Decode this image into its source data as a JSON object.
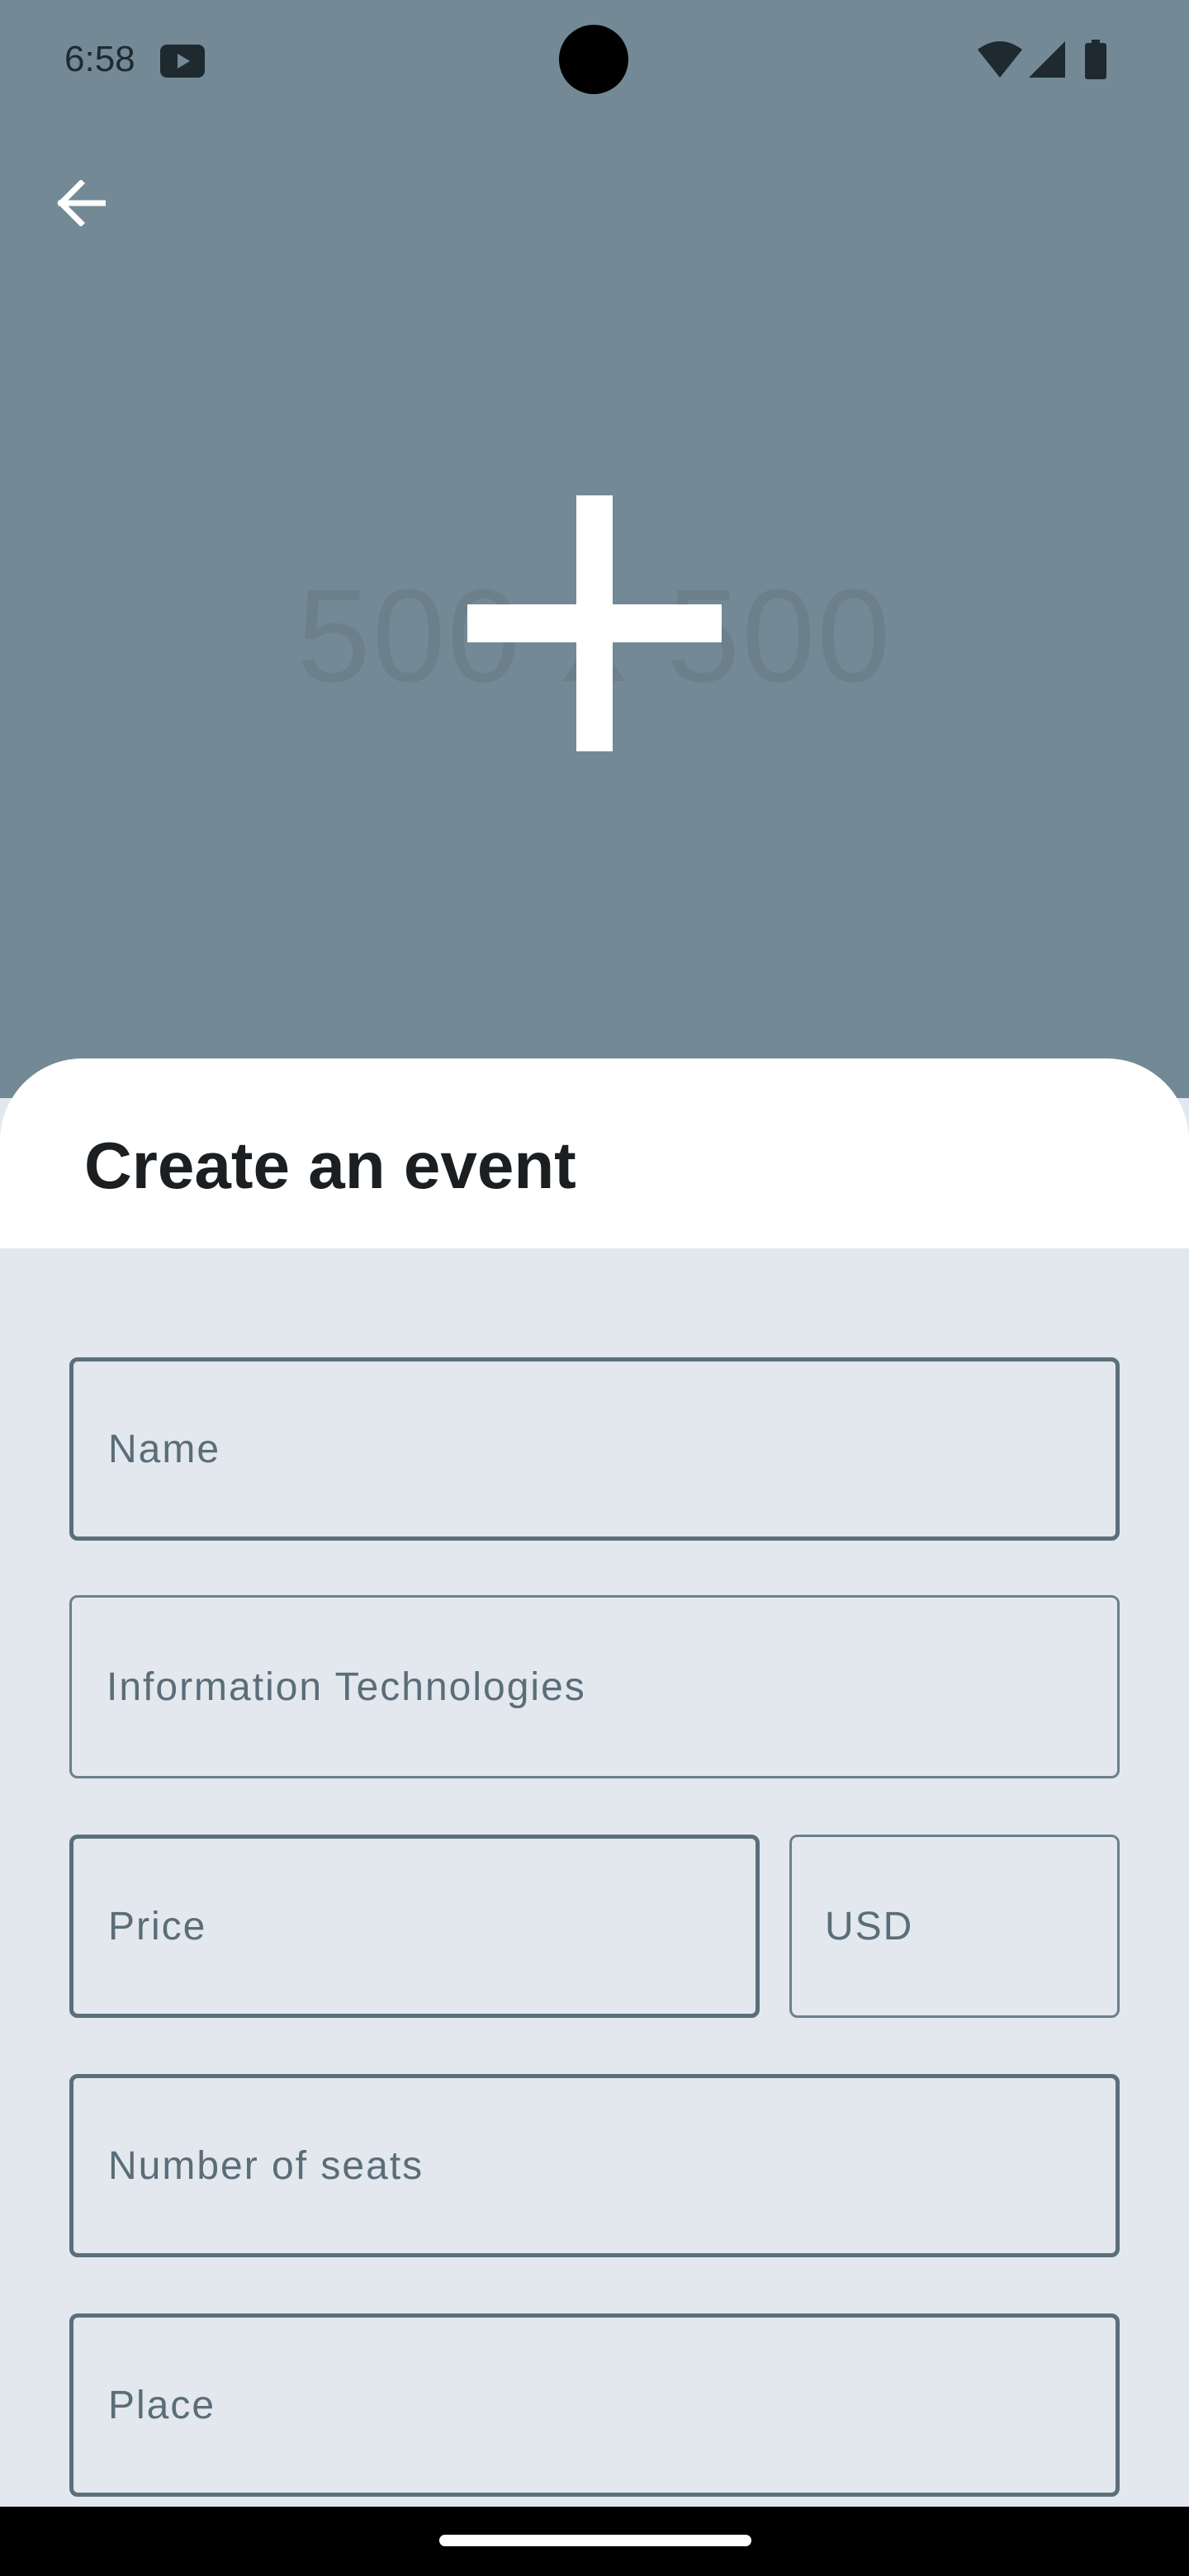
{
  "status_bar": {
    "time": "6:58"
  },
  "header": {
    "back_icon": "arrow-left-icon",
    "image_placeholder_text": "500 x 500",
    "add_image_icon": "plus-icon",
    "background_color": "#738a96"
  },
  "sheet": {
    "title": "Create an event"
  },
  "form": {
    "name_placeholder": "Name",
    "category_value": "Information Technologies",
    "price_placeholder": "Price",
    "currency_value": "USD",
    "seats_placeholder": "Number of seats",
    "place_placeholder": "Place"
  },
  "colors": {
    "form_background": "#e2e8ee",
    "field_border": "#5b6f7b",
    "field_text": "#5a6d78"
  }
}
